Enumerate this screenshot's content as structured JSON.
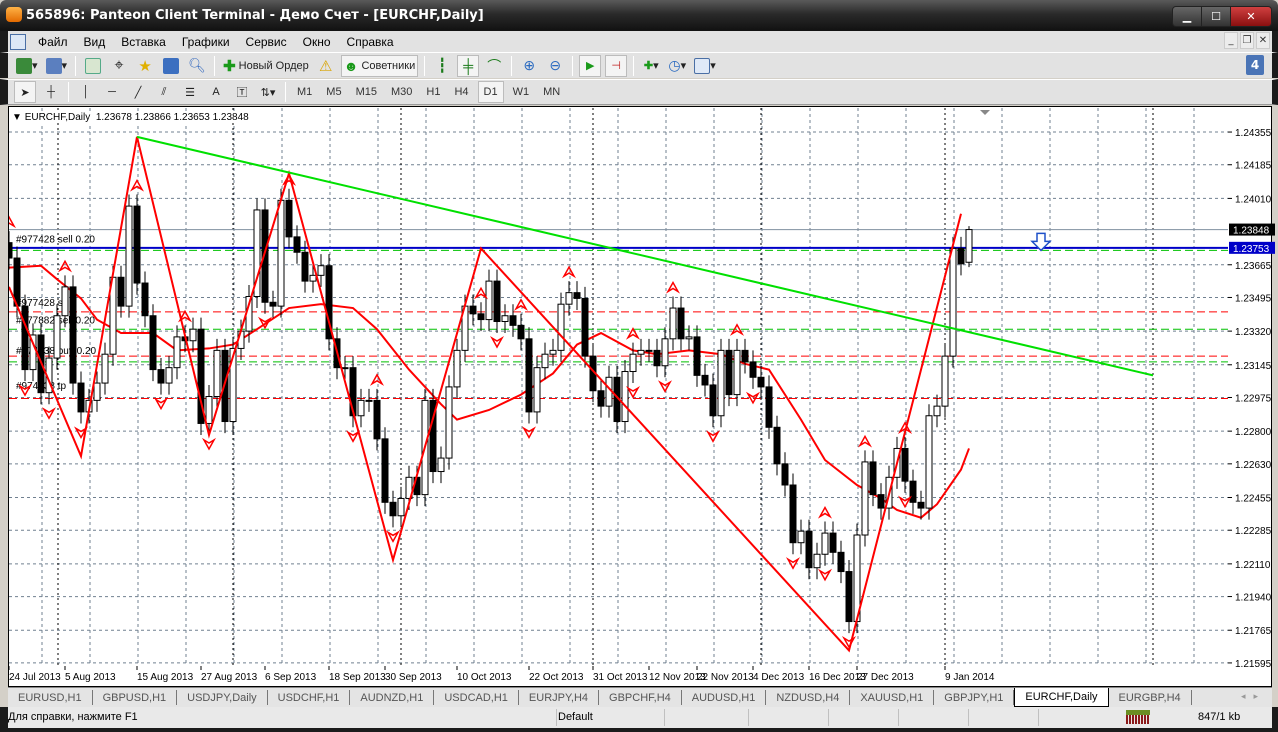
{
  "window": {
    "title": "565896: Panteon Client Terminal - Демо Счет - [EURCHF,Daily]",
    "buttons": [
      "minimize",
      "maximize",
      "close"
    ]
  },
  "menu": [
    "Файл",
    "Вид",
    "Вставка",
    "Графики",
    "Сервис",
    "Окно",
    "Справка"
  ],
  "toolbar": {
    "new_order": "Новый Ордер",
    "experts": "Советники",
    "timeframes": [
      "M1",
      "M5",
      "M15",
      "M30",
      "H1",
      "H4",
      "D1",
      "W1",
      "MN"
    ],
    "active_timeframe": "D1",
    "notification_count": "4"
  },
  "chart_header": {
    "symbol": "EURCHF,Daily",
    "ohlc": "1.23678 1.23866 1.23653 1.23848"
  },
  "order_labels": [
    "#977428 sell 0.20",
    "#977428 sl",
    "#977882 sell 0.20",
    "#974438 buy 0.20",
    "#974438 tp"
  ],
  "tabs": [
    "EURUSD,H1",
    "GBPUSD,H1",
    "USDJPY,Daily",
    "USDCHF,H1",
    "AUDNZD,H1",
    "USDCAD,H1",
    "EURJPY,H4",
    "GBPCHF,H4",
    "AUDUSD,H1",
    "NZDUSD,H4",
    "XAUUSD,H1",
    "GBPJPY,H1",
    "EURCHF,Daily",
    "EURGBP,H4"
  ],
  "active_tab": "EURCHF,Daily",
  "status": {
    "help": "Для справки, нажмите F1",
    "profile": "Default",
    "traffic": "847/1 kb"
  },
  "colors": {
    "zigzag": "#ff0000",
    "ma": "#ff0000",
    "trendline": "#00e000",
    "order_line": "#0000c8",
    "sl_line": "#ff0000",
    "entry_line": "#00c000",
    "grid": "#708090",
    "bid_label_bg": "#000000",
    "order_label_bg": "#0000c8"
  },
  "chart_data": {
    "type": "candlestick",
    "symbol": "EURCHF",
    "period": "Daily",
    "ylim": [
      1.21579,
      1.2448
    ],
    "y_ticks": [
      "1.24355",
      "1.24185",
      "1.24010",
      "1.23665",
      "1.23495",
      "1.23320",
      "1.23145",
      "1.22975",
      "1.22800",
      "1.22630",
      "1.22455",
      "1.22285",
      "1.22110",
      "1.21940",
      "1.21765",
      "1.21595"
    ],
    "x_ticks": [
      {
        "bar": 0,
        "label": "24 Jul 2013"
      },
      {
        "bar": 7,
        "label": "5 Aug 2013"
      },
      {
        "bar": 16,
        "label": "15 Aug 2013"
      },
      {
        "bar": 24,
        "label": "27 Aug 2013"
      },
      {
        "bar": 32,
        "label": "6 Sep 2013"
      },
      {
        "bar": 40,
        "label": "18 Sep 2013"
      },
      {
        "bar": 47,
        "label": "30 Sep 2013"
      },
      {
        "bar": 56,
        "label": "10 Oct 2013"
      },
      {
        "bar": 65,
        "label": "22 Oct 2013"
      },
      {
        "bar": 73,
        "label": "31 Oct 2013"
      },
      {
        "bar": 80,
        "label": "12 Nov 2013"
      },
      {
        "bar": 86,
        "label": "22 Nov 2013"
      },
      {
        "bar": 93,
        "label": "4 Dec 2013"
      },
      {
        "bar": 100,
        "label": "16 Dec 2013"
      },
      {
        "bar": 106,
        "label": "27 Dec 2013"
      },
      {
        "bar": 117,
        "label": "9 Jan 2014"
      }
    ],
    "first_open": 1.2378,
    "close": [
      1.237,
      1.2345,
      1.2312,
      1.233,
      1.23,
      1.2318,
      1.234,
      1.2355,
      1.2305,
      1.229,
      1.2296,
      1.2305,
      1.232,
      1.236,
      1.2345,
      1.2397,
      1.2357,
      1.234,
      1.2312,
      1.2305,
      1.2313,
      1.2329,
      1.2327,
      1.2333,
      1.2284,
      1.2298,
      1.2322,
      1.2285,
      1.2323,
      1.2332,
      1.235,
      1.2395,
      1.2347,
      1.2345,
      1.24,
      1.2381,
      1.2373,
      1.2358,
      1.2361,
      1.2366,
      1.2328,
      1.2313,
      1.2313,
      1.2288,
      1.2296,
      1.2296,
      1.2276,
      1.2243,
      1.2236,
      1.2245,
      1.2256,
      1.2247,
      1.2296,
      1.2259,
      1.2266,
      1.2303,
      1.2322,
      1.2345,
      1.2341,
      1.2338,
      1.2358,
      1.2337,
      1.234,
      1.2335,
      1.2328,
      1.229,
      1.2313,
      1.232,
      1.2322,
      1.2346,
      1.2352,
      1.2349,
      1.2319,
      1.2301,
      1.2293,
      1.2308,
      1.2285,
      1.2311,
      1.232,
      1.2322,
      1.2322,
      1.2314,
      1.2328,
      1.2344,
      1.2328,
      1.2329,
      1.2309,
      1.2304,
      1.2288,
      1.2322,
      1.2299,
      1.2322,
      1.2316,
      1.2308,
      1.2303,
      1.2282,
      1.2263,
      1.2252,
      1.2222,
      1.2228,
      1.2209,
      1.2216,
      1.2227,
      1.2217,
      1.2207,
      1.2181,
      1.2226,
      1.2264,
      1.2247,
      1.224,
      1.2256,
      1.2271,
      1.2254,
      1.2243,
      1.224,
      1.2288,
      1.2293,
      1.2319,
      1.2375,
      1.2367,
      1.23848
    ],
    "last_bar": {
      "open": 1.23678,
      "high": 1.23866,
      "low": 1.23653,
      "close": 1.23848
    },
    "zigzag": [
      {
        "bar": 0,
        "price": 1.2355
      },
      {
        "bar": 9,
        "price": 1.2267
      },
      {
        "bar": 16,
        "price": 1.2433
      },
      {
        "bar": 25,
        "price": 1.2278
      },
      {
        "bar": 35,
        "price": 1.2414
      },
      {
        "bar": 48,
        "price": 1.2213
      },
      {
        "bar": 59,
        "price": 1.2375
      },
      {
        "bar": 105,
        "price": 1.2166
      },
      {
        "bar": 119,
        "price": 1.2393
      }
    ],
    "moving_average": [
      {
        "bar": 0,
        "price": 1.2365
      },
      {
        "bar": 4,
        "price": 1.2366
      },
      {
        "bar": 6,
        "price": 1.2359
      },
      {
        "bar": 9,
        "price": 1.2349
      },
      {
        "bar": 11,
        "price": 1.2338
      },
      {
        "bar": 14,
        "price": 1.2331
      },
      {
        "bar": 18,
        "price": 1.2331
      },
      {
        "bar": 21,
        "price": 1.2322
      },
      {
        "bar": 25,
        "price": 1.2323
      },
      {
        "bar": 28,
        "price": 1.2325
      },
      {
        "bar": 31,
        "price": 1.2333
      },
      {
        "bar": 35,
        "price": 1.2344
      },
      {
        "bar": 39,
        "price": 1.2346
      },
      {
        "bar": 43,
        "price": 1.2344
      },
      {
        "bar": 46,
        "price": 1.2333
      },
      {
        "bar": 50,
        "price": 1.2312
      },
      {
        "bar": 54,
        "price": 1.2294
      },
      {
        "bar": 56,
        "price": 1.2286
      },
      {
        "bar": 60,
        "price": 1.2291
      },
      {
        "bar": 64,
        "price": 1.2299
      },
      {
        "bar": 68,
        "price": 1.231
      },
      {
        "bar": 71,
        "price": 1.2325
      },
      {
        "bar": 74,
        "price": 1.2331
      },
      {
        "bar": 78,
        "price": 1.2322
      },
      {
        "bar": 81,
        "price": 1.232
      },
      {
        "bar": 85,
        "price": 1.2322
      },
      {
        "bar": 89,
        "price": 1.232
      },
      {
        "bar": 92,
        "price": 1.2315
      },
      {
        "bar": 95,
        "price": 1.2312
      },
      {
        "bar": 99,
        "price": 1.2286
      },
      {
        "bar": 102,
        "price": 1.2265
      },
      {
        "bar": 106,
        "price": 1.2252
      },
      {
        "bar": 109,
        "price": 1.2245
      },
      {
        "bar": 111,
        "price": 1.2239
      },
      {
        "bar": 114,
        "price": 1.2235
      },
      {
        "bar": 116,
        "price": 1.2242
      },
      {
        "bar": 119,
        "price": 1.226
      },
      {
        "bar": 120,
        "price": 1.2271
      }
    ],
    "trendline": [
      {
        "bar": 16,
        "price": 1.2433
      },
      {
        "bar": 143,
        "price": 1.2309
      }
    ],
    "fractals_up": [
      0,
      7,
      16,
      22,
      35,
      46,
      59,
      64,
      70,
      78,
      83,
      91,
      102,
      107,
      112
    ],
    "fractals_down": [
      2,
      5,
      9,
      19,
      25,
      32,
      43,
      48,
      61,
      65,
      78,
      82,
      88,
      93,
      98,
      102,
      105,
      112
    ],
    "hlines": [
      {
        "price": 1.23848,
        "kind": "bid",
        "label": "1.23848"
      },
      {
        "price": 1.23753,
        "kind": "order",
        "label": "1.23753"
      },
      {
        "price": 1.2374,
        "kind": "entry"
      },
      {
        "price": 1.2342,
        "kind": "sl"
      },
      {
        "price": 1.2333,
        "kind": "entry"
      },
      {
        "price": 1.2319,
        "kind": "sl"
      },
      {
        "price": 1.2316,
        "kind": "entry"
      },
      {
        "price": 1.2297,
        "kind": "sl"
      }
    ],
    "sell_arrow": {
      "bar": 129,
      "price": 1.2375
    }
  }
}
